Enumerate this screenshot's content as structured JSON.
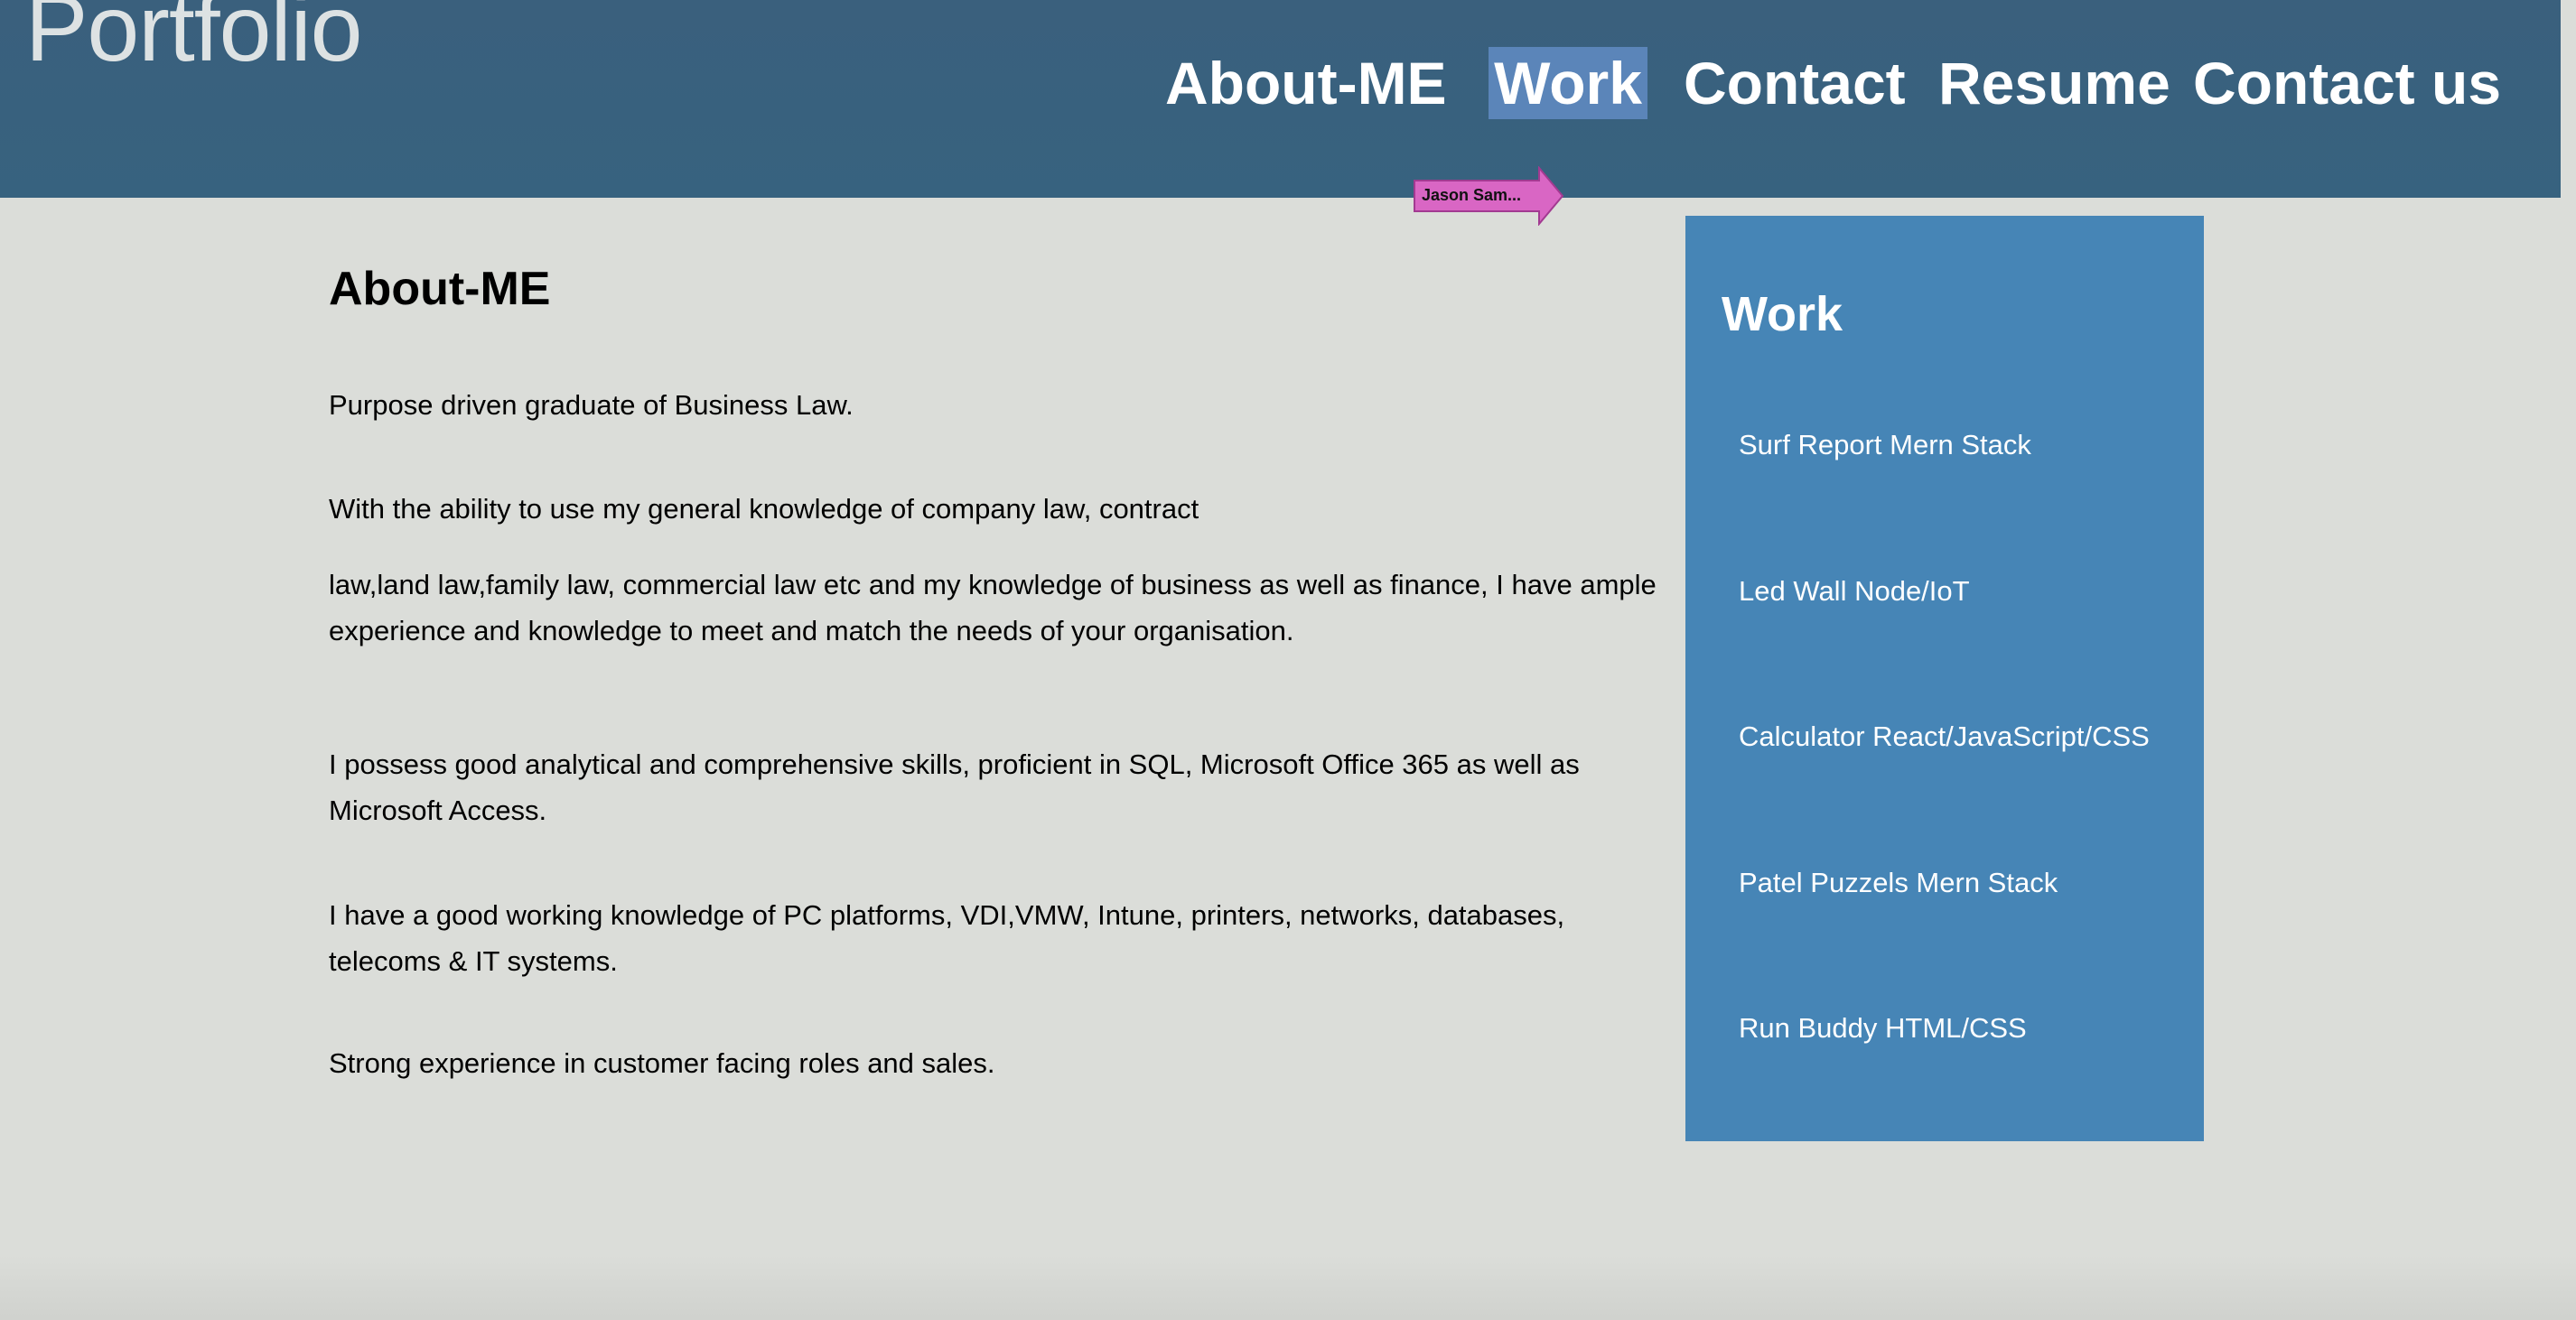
{
  "header": {
    "brand": "Portfolio",
    "nav": [
      "About-ME",
      "Work",
      "Contact",
      "Resume",
      "Contact us"
    ],
    "active_nav": "Work",
    "colors": {
      "background": "#3a607d",
      "active_highlight": "#5b85b9",
      "brand_text": "#dde2e3"
    }
  },
  "annotation": {
    "label": "Jason Sam...",
    "color": "#d966c4",
    "icon": "arrow-right-icon"
  },
  "about": {
    "title": "About-ME",
    "paragraphs": [
      "Purpose driven graduate of Business Law.",
      "With the ability to use my general knowledge of company law, contract",
      "law,land law,family law, commercial law etc and my knowledge of business as well as finance, I have ample experience and knowledge to meet and match the needs of your organisation.",
      "I possess good analytical and comprehensive skills, proficient in SQL, Microsoft Office 365 as well as Microsoft Access.",
      "I have a good working knowledge of PC platforms, VDI,VMW, Intune, printers, networks, databases, telecoms & IT systems.",
      "Strong experience in customer facing roles and sales."
    ]
  },
  "work": {
    "title": "Work",
    "items": [
      "Surf Report Mern Stack",
      "Led Wall Node/IoT",
      "Calculator React/JavaScript/CSS",
      "Patel Puzzels Mern Stack",
      "Run Buddy HTML/CSS"
    ],
    "colors": {
      "panel": "#4685b6"
    }
  }
}
